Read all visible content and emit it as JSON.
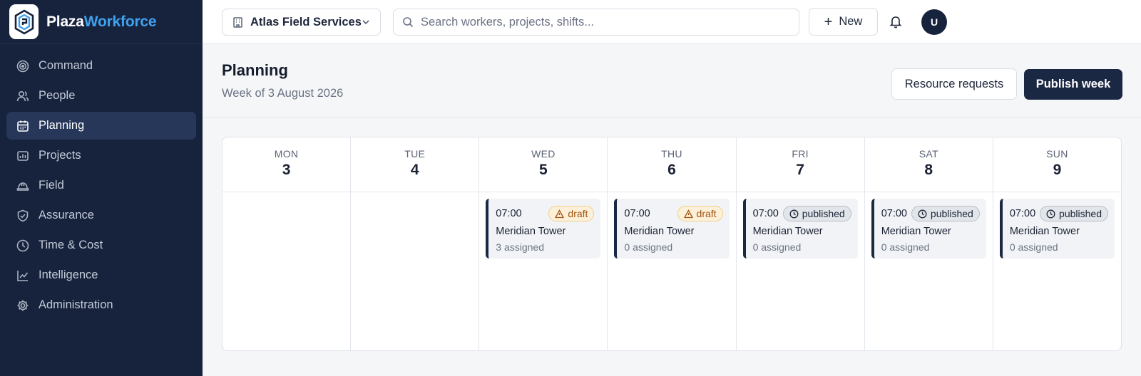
{
  "brand": {
    "part1": "Plaza",
    "part2": "Workforce"
  },
  "sidebar": {
    "items": [
      {
        "label": "Command",
        "icon": "target-icon",
        "active": false
      },
      {
        "label": "People",
        "icon": "people-icon",
        "active": false
      },
      {
        "label": "Planning",
        "icon": "calendar-icon",
        "active": true
      },
      {
        "label": "Projects",
        "icon": "projects-icon",
        "active": false
      },
      {
        "label": "Field",
        "icon": "hardhat-icon",
        "active": false
      },
      {
        "label": "Assurance",
        "icon": "shield-icon",
        "active": false
      },
      {
        "label": "Time & Cost",
        "icon": "clock-icon",
        "active": false
      },
      {
        "label": "Intelligence",
        "icon": "chart-icon",
        "active": false
      },
      {
        "label": "Administration",
        "icon": "gear-icon",
        "active": false
      }
    ]
  },
  "topbar": {
    "org": "Atlas Field Services",
    "search_placeholder": "Search workers, projects, shifts...",
    "new_label": "New",
    "avatar_initial": "U"
  },
  "page": {
    "title": "Planning",
    "subtitle": "Week of 3 August 2026",
    "secondary_action": "Resource requests",
    "primary_action": "Publish week"
  },
  "calendar": {
    "days": [
      {
        "dow": "MON",
        "date": "3",
        "shift": null
      },
      {
        "dow": "TUE",
        "date": "4",
        "shift": null
      },
      {
        "dow": "WED",
        "date": "5",
        "shift": {
          "time": "07:00",
          "status": "draft",
          "project": "Meridian Tower",
          "assigned": "3 assigned"
        }
      },
      {
        "dow": "THU",
        "date": "6",
        "shift": {
          "time": "07:00",
          "status": "draft",
          "project": "Meridian Tower",
          "assigned": "0 assigned"
        }
      },
      {
        "dow": "FRI",
        "date": "7",
        "shift": {
          "time": "07:00",
          "status": "published",
          "project": "Meridian Tower",
          "assigned": "0 assigned"
        }
      },
      {
        "dow": "SAT",
        "date": "8",
        "shift": {
          "time": "07:00",
          "status": "published",
          "project": "Meridian Tower",
          "assigned": "0 assigned"
        }
      },
      {
        "dow": "SUN",
        "date": "9",
        "shift": {
          "time": "07:00",
          "status": "published",
          "project": "Meridian Tower",
          "assigned": "0 assigned"
        }
      }
    ]
  },
  "colors": {
    "sidebar_bg": "#17233d",
    "accent_blue": "#3fa2f0",
    "primary_button": "#1b2843",
    "draft_badge": "#fdf0d8",
    "published_badge": "#e2e5ea"
  }
}
